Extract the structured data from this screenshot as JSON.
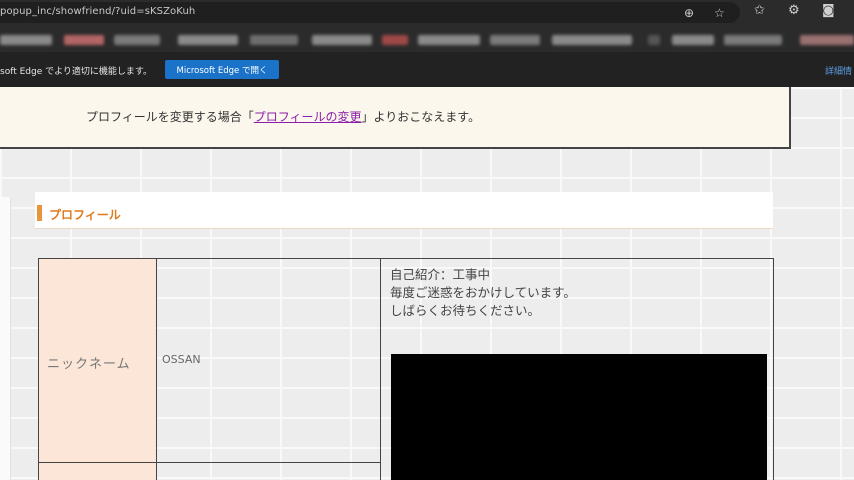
{
  "browser": {
    "url": "popup_inc/showfriend/?uid=sKSZoKuh",
    "icons": {
      "zoom": "zoom-icon",
      "favorite": "star-icon",
      "favorites_bar": "favorites-icon",
      "extensions": "extensions-icon",
      "profile": "profile-icon"
    },
    "infobar": {
      "message": "soft Edge でより適切に機能します。",
      "open_button": "Microsoft Edge で開く",
      "details_link": "詳細情"
    }
  },
  "notice": {
    "line_prefix": "プロフィールを変更する場合「",
    "link_text": "プロフィールの変更",
    "line_suffix": "」よりおこなえます。"
  },
  "section": {
    "title": "プロフィール"
  },
  "profile_table": {
    "nickname_label": "ニックネーム",
    "nickname_value": "OSSAN",
    "intro_lines": [
      "自己紹介：工事中",
      "毎度ご迷惑をおかけしています。",
      "しばらくお待ちください。"
    ]
  }
}
